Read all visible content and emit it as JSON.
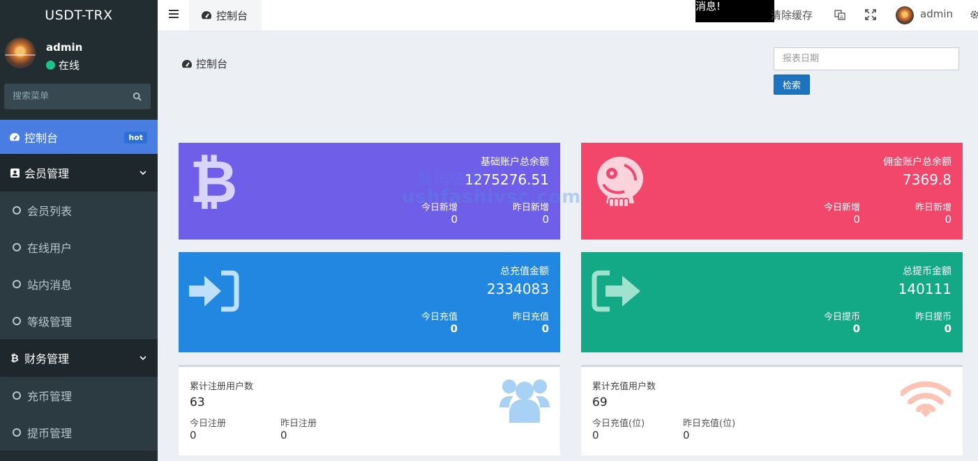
{
  "sidebar": {
    "brand": "USDT-TRX",
    "user": {
      "name": "admin",
      "status": "在线"
    },
    "search_placeholder": "搜索菜单",
    "menu": {
      "dashboard": {
        "label": "控制台",
        "badge": "hot"
      },
      "members": {
        "label": "会员管理",
        "items": [
          "会员列表",
          "在线用户",
          "站内消息",
          "等级管理"
        ]
      },
      "finance": {
        "label": "财务管理",
        "items": [
          "充币管理",
          "提币管理"
        ]
      }
    }
  },
  "navbar": {
    "tab_label": "控制台",
    "message": "消息!",
    "clear_cache": "清除缓存",
    "user": "admin"
  },
  "content": {
    "title": "控制台",
    "date_placeholder": "报表日期",
    "search_label": "检索",
    "watermark_top": "易码资源",
    "watermark": "ushfashivsc.com",
    "cards": {
      "base_balance": {
        "title": "基础账户总余额",
        "value": "1275276.51",
        "today_label": "今日新增",
        "today": "0",
        "yesterday_label": "昨日新增",
        "yesterday": "0",
        "color": "#6f5ee8"
      },
      "commission_balance": {
        "title": "佣金账户总余额",
        "value": "7369.8",
        "today_label": "今日新增",
        "today": "0",
        "yesterday_label": "昨日新增",
        "yesterday": "0",
        "color": "#f2476b"
      },
      "total_recharge": {
        "title": "总充值金额",
        "value": "2334083",
        "today_label": "今日充值",
        "today": "0",
        "yesterday_label": "昨日充值",
        "yesterday": "0",
        "color": "#2287e0"
      },
      "total_withdraw": {
        "title": "总提币金额",
        "value": "140111",
        "today_label": "今日提币",
        "today": "0",
        "yesterday_label": "昨日提币",
        "yesterday": "0",
        "color": "#13a886"
      },
      "registered_users": {
        "title": "累计注册用户数",
        "value": "63",
        "today_label": "今日注册",
        "today": "0",
        "yesterday_label": "昨日注册",
        "yesterday": "0"
      },
      "recharge_users": {
        "title": "累计充值用户数",
        "value": "69",
        "today_label": "今日充值(位)",
        "today": "0",
        "yesterday_label": "昨日充值(位)",
        "yesterday": "0"
      }
    }
  }
}
